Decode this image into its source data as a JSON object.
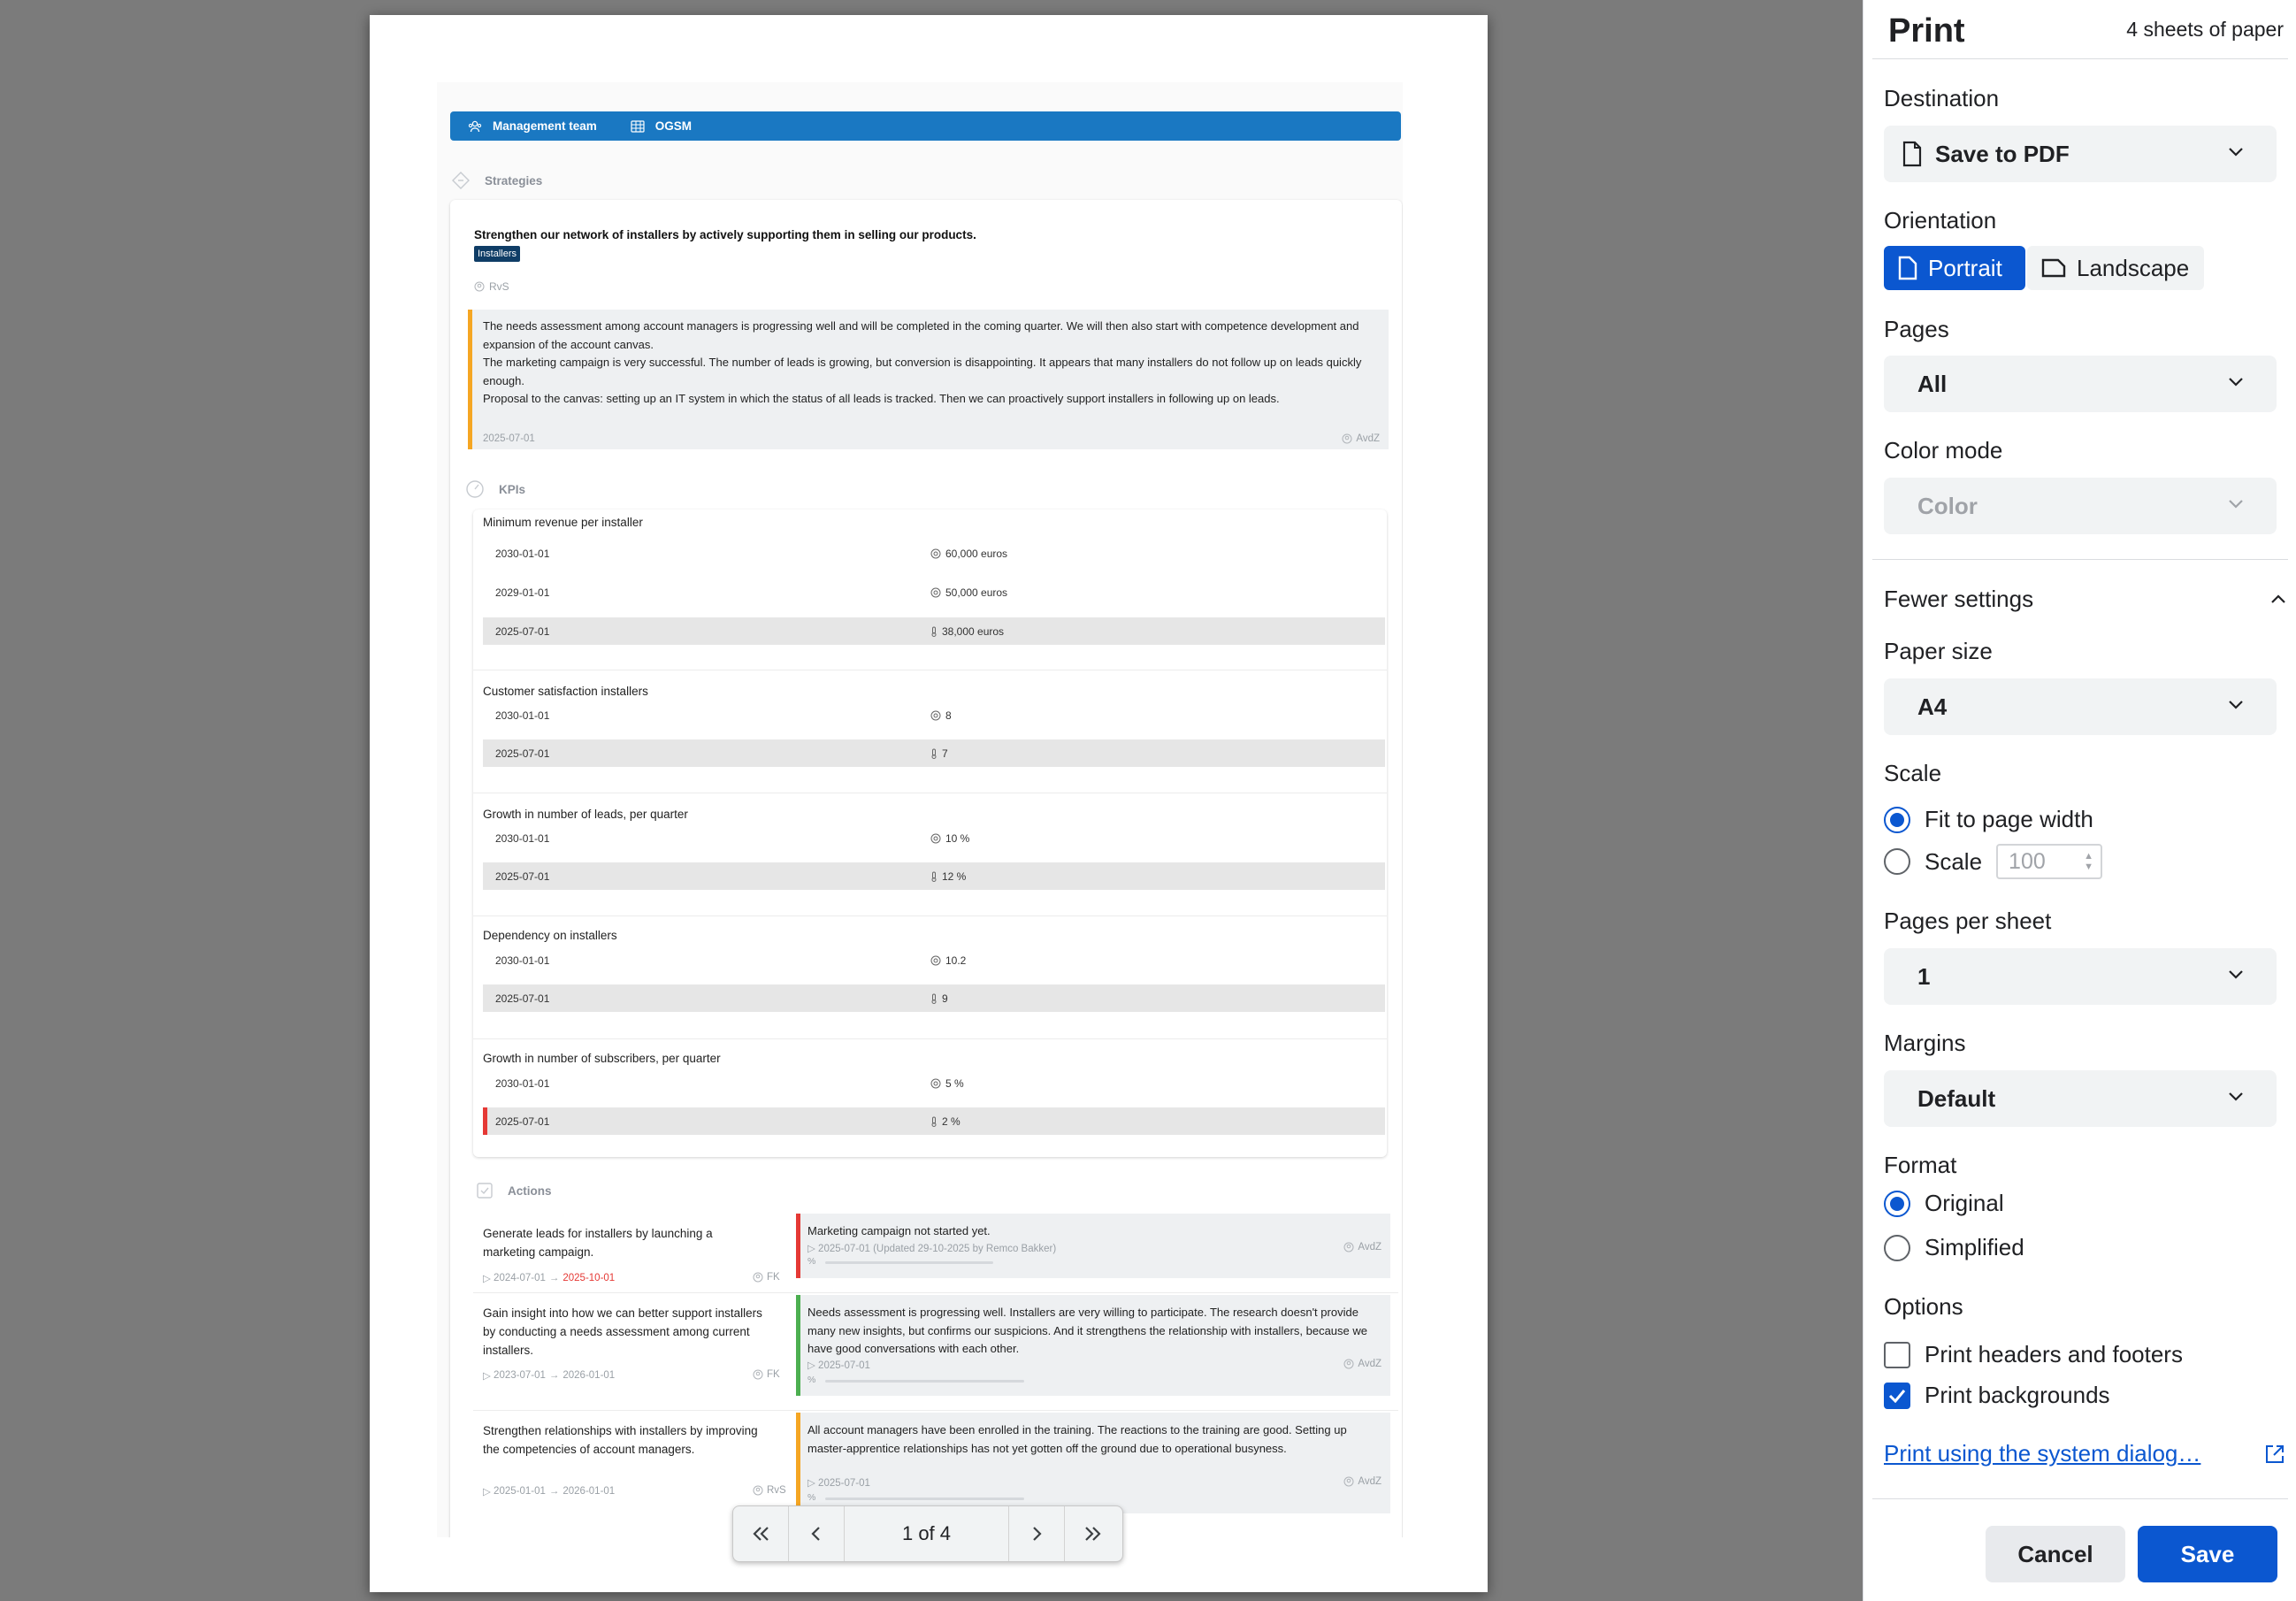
{
  "preview": {
    "header": {
      "team": "Management team",
      "view": "OGSM"
    },
    "strategies": {
      "heading": "Strategies",
      "title": "Strengthen our network of installers by actively supporting them in selling our products.",
      "tag": "Installers",
      "owner": "RvS",
      "note": {
        "lines": [
          "The needs assessment among account managers is progressing well and will be completed in the coming quarter. We will then also start with competence development and expansion of the account canvas.",
          "The marketing campaign is very successful. The number of leads is growing, but conversion is disappointing. It appears that many installers do not follow up on leads quickly enough.",
          "Proposal to the canvas: setting up an IT system in which the status of all leads is tracked. Then we can proactively support installers in following up on leads."
        ],
        "date": "2025-07-01",
        "owner": "AvdZ"
      }
    },
    "kpis": {
      "heading": "KPIs",
      "items": [
        {
          "title": "Minimum revenue per installer",
          "rows": [
            {
              "date": "2030-01-01",
              "value": "60,000 euros"
            },
            {
              "date": "2029-01-01",
              "value": "50,000 euros"
            },
            {
              "date": "2025-07-01",
              "value": "38,000 euros"
            }
          ]
        },
        {
          "title": "Customer satisfaction installers",
          "rows": [
            {
              "date": "2030-01-01",
              "value": "8"
            },
            {
              "date": "2025-07-01",
              "value": "7"
            }
          ]
        },
        {
          "title": "Growth in number of leads, per quarter",
          "rows": [
            {
              "date": "2030-01-01",
              "value": "10 %"
            },
            {
              "date": "2025-07-01",
              "value": "12 %"
            }
          ]
        },
        {
          "title": "Dependency on installers",
          "rows": [
            {
              "date": "2030-01-01",
              "value": "10.2"
            },
            {
              "date": "2025-07-01",
              "value": "9"
            }
          ]
        },
        {
          "title": "Growth in number of subscribers, per quarter",
          "rows": [
            {
              "date": "2030-01-01",
              "value": "5 %"
            },
            {
              "date": "2025-07-01",
              "value": "2 %"
            }
          ]
        }
      ]
    },
    "actions": {
      "heading": "Actions",
      "items": [
        {
          "title": "Generate leads for installers by launching a marketing campaign.",
          "start": "2024-07-01",
          "arrow": "→",
          "end": "2025-10-01",
          "owner": "FK",
          "status": "Marketing campaign not started yet.",
          "status_date": "2025-07-01 (Updated 29-10-2025 by Remco Bakker)",
          "status_owner": "AvdZ",
          "progress_pct": 0
        },
        {
          "title": "Gain insight into how we can better support installers by conducting a needs assessment among current installers.",
          "start": "2023-07-01",
          "arrow": "→",
          "end": "2026-01-01",
          "owner": "FK",
          "status": "Needs assessment is progressing well. Installers are very willing to participate. The research doesn't provide many new insights, but confirms our suspicions. And it strengthens the relationship with installers, because we have good conversations with each other.",
          "status_date": "2025-07-01",
          "status_owner": "AvdZ",
          "progress_pct": 0
        },
        {
          "title": "Strengthen relationships with installers by improving the competencies of account managers.",
          "start": "2025-01-01",
          "arrow": "→",
          "end": "2026-01-01",
          "owner": "RvS",
          "status": "All account managers have been enrolled in the training. The reactions to the training are good. Setting up master-apprentice relationships has not yet gotten off the ground due to operational busyness.",
          "status_date": "2025-07-01",
          "status_owner": "AvdZ",
          "progress_pct": 0
        }
      ]
    },
    "pager": {
      "label": "1 of 4"
    }
  },
  "panel": {
    "title": "Print",
    "sheets": "4 sheets of paper",
    "destination": {
      "label": "Destination",
      "value": "Save to PDF"
    },
    "orientation": {
      "label": "Orientation",
      "portrait": "Portrait",
      "landscape": "Landscape",
      "selected": "Portrait"
    },
    "pages": {
      "label": "Pages",
      "value": "All"
    },
    "color_mode": {
      "label": "Color mode",
      "value": "Color"
    },
    "fewer_settings": "Fewer settings",
    "paper_size": {
      "label": "Paper size",
      "value": "A4"
    },
    "scale": {
      "label": "Scale",
      "fit": "Fit to page width",
      "custom": "Scale",
      "custom_value": "100",
      "selected": "fit"
    },
    "pages_per_sheet": {
      "label": "Pages per sheet",
      "value": "1"
    },
    "margins": {
      "label": "Margins",
      "value": "Default"
    },
    "format": {
      "label": "Format",
      "original": "Original",
      "simplified": "Simplified",
      "selected": "original"
    },
    "options": {
      "label": "Options",
      "headers_footers": "Print headers and footers",
      "headers_footers_checked": false,
      "backgrounds": "Print backgrounds",
      "backgrounds_checked": true
    },
    "system_dialog": "Print using the system dialog…",
    "cancel": "Cancel",
    "save": "Save"
  },
  "colors": {
    "accent": "#0b57d0",
    "header_bar": "#1a78c2",
    "tag": "#0f3d66",
    "status_red": "#e53935",
    "status_green": "#4caf50",
    "status_orange": "#f5a623"
  }
}
